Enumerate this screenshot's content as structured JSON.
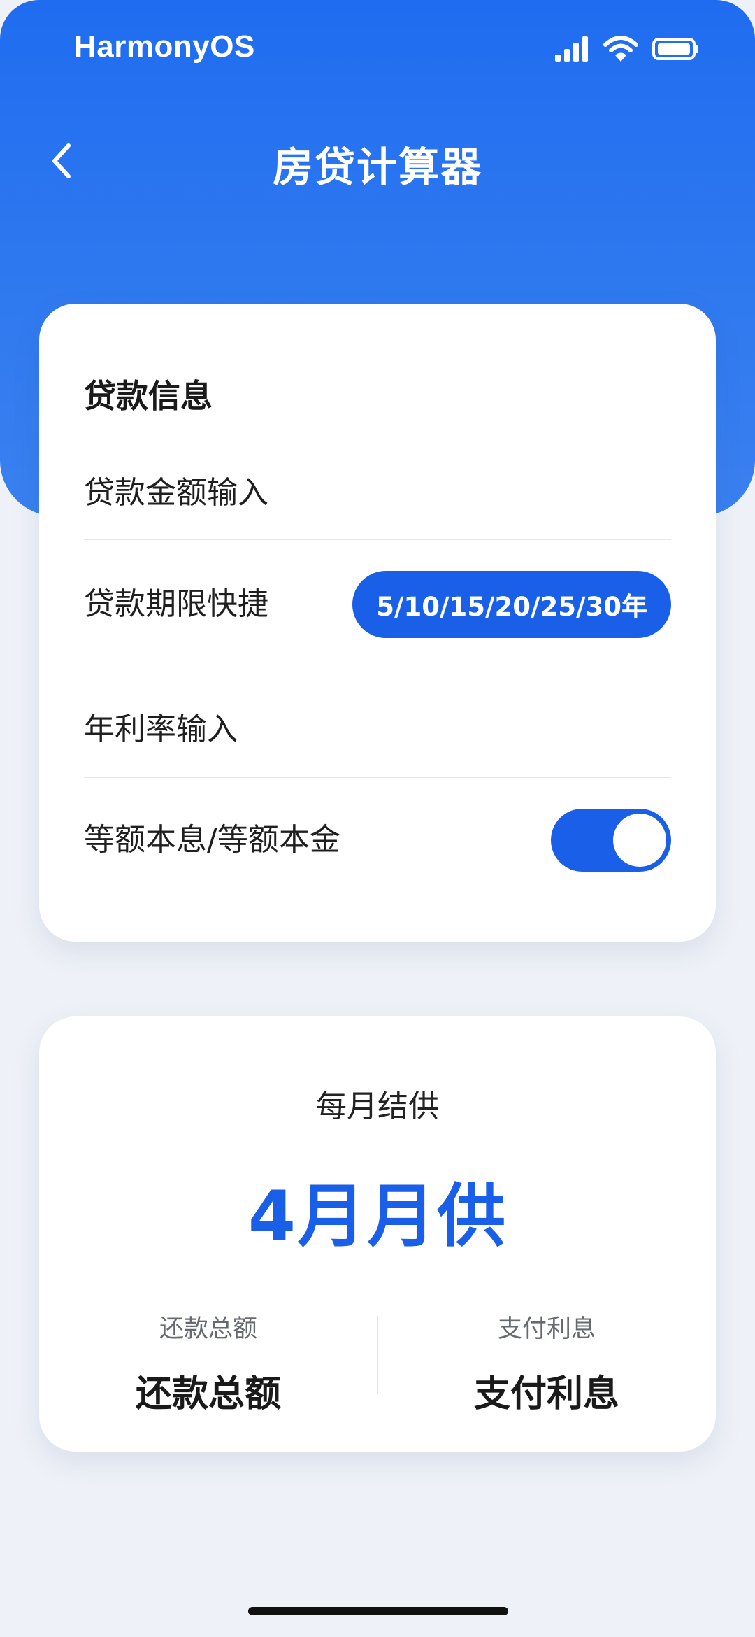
{
  "status_bar": {
    "brand": "HarmonyOS",
    "icons": [
      "signal-icon",
      "wifi-icon",
      "battery-icon"
    ]
  },
  "header": {
    "back_icon": "chevron-left-icon",
    "title": "房贷计算器"
  },
  "loan_card": {
    "section_title": "贷款信息",
    "amount_label": "贷款金额输入",
    "term_label": "贷款期限快捷",
    "term_options": "5/10/15/20/25/30年",
    "rate_label": "年利率输入",
    "method_label": "等额本息/等额本金",
    "method_toggle_on": true
  },
  "result_card": {
    "monthly_label": "每月结供",
    "monthly_value": "4月月供",
    "total_caption": "还款总额",
    "total_value": "还款总额",
    "interest_caption": "支付利息",
    "interest_value": "支付利息"
  },
  "colors": {
    "primary": "#1a5fe8",
    "header_bg": "#2f79ef",
    "page_bg": "#eef1f7"
  }
}
